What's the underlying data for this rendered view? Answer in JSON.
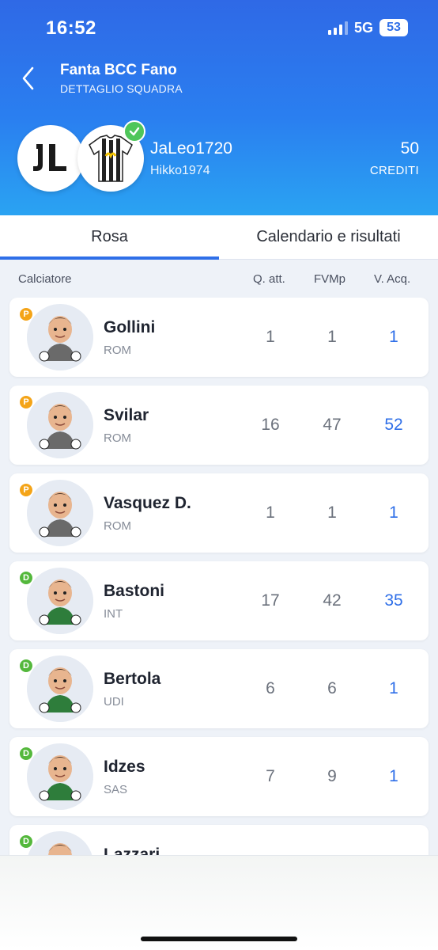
{
  "status": {
    "time": "16:52",
    "network": "5G",
    "battery": "53"
  },
  "header": {
    "title": "Fanta BCC Fano",
    "subtitle": "DETTAGLIO SQUADRA"
  },
  "team": {
    "name": "JaLeo1720",
    "owner": "Hikko1974",
    "credits_value": "50",
    "credits_label": "CREDITI"
  },
  "tabs": [
    {
      "label": "Rosa",
      "active": true
    },
    {
      "label": "Calendario e risultati",
      "active": false
    }
  ],
  "columns": {
    "player": "Calciatore",
    "quotation": "Q. att.",
    "fvmp": "FVMp",
    "purchase": "V. Acq."
  },
  "colors": {
    "accent": "#2f6fe8",
    "role_P": "#f4a418",
    "role_D": "#54b83c"
  },
  "players": [
    {
      "role": "P",
      "name": "Gollini",
      "team": "ROM",
      "q": "1",
      "fvmp": "1",
      "va": "1"
    },
    {
      "role": "P",
      "name": "Svilar",
      "team": "ROM",
      "q": "16",
      "fvmp": "47",
      "va": "52"
    },
    {
      "role": "P",
      "name": "Vasquez D.",
      "team": "ROM",
      "q": "1",
      "fvmp": "1",
      "va": "1"
    },
    {
      "role": "D",
      "name": "Bastoni",
      "team": "INT",
      "q": "17",
      "fvmp": "42",
      "va": "35"
    },
    {
      "role": "D",
      "name": "Bertola",
      "team": "UDI",
      "q": "6",
      "fvmp": "6",
      "va": "1"
    },
    {
      "role": "D",
      "name": "Idzes",
      "team": "SAS",
      "q": "7",
      "fvmp": "9",
      "va": "1"
    },
    {
      "role": "D",
      "name": "Lazzari",
      "team": "",
      "q": "",
      "fvmp": "",
      "va": ""
    }
  ]
}
